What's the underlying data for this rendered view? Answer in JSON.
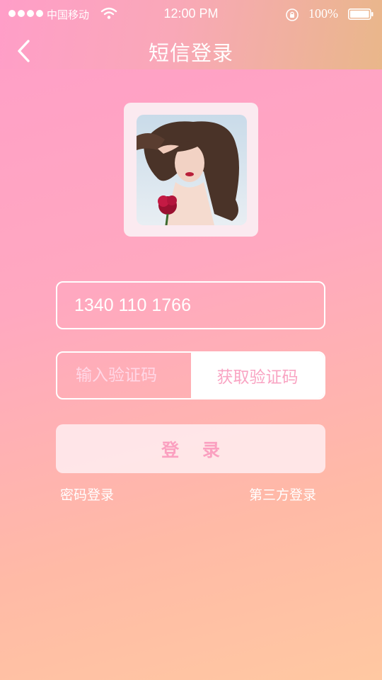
{
  "status_bar": {
    "carrier": "中国移动",
    "time": "12:00 PM",
    "battery": "100%"
  },
  "nav": {
    "title": "短信登录"
  },
  "form": {
    "phone_value": "1340 110 1766",
    "code_placeholder": "输入验证码",
    "get_code_label": "获取验证码",
    "login_label": "登 录"
  },
  "links": {
    "password_login": "密码登录",
    "third_party_login": "第三方登录"
  }
}
